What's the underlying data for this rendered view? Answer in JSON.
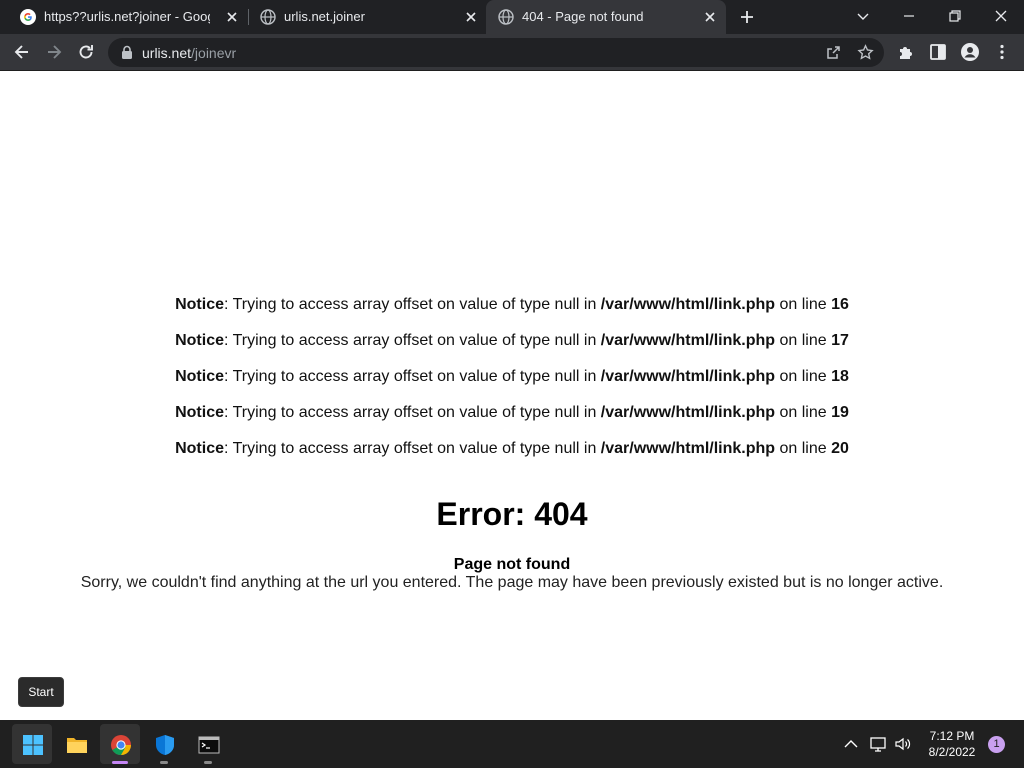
{
  "browser": {
    "tabs": [
      {
        "title": "https??urlis.net?joiner - Google S",
        "favicon": "google-g-icon",
        "active": false
      },
      {
        "title": "urlis.net.joiner",
        "favicon": "globe-icon",
        "active": false
      },
      {
        "title": "404 - Page not found",
        "favicon": "globe-icon",
        "active": true
      }
    ],
    "address": {
      "host": "urlis.net",
      "path": "/joinevr"
    }
  },
  "page": {
    "notices": [
      {
        "label": "Notice",
        "text": ": Trying to access array offset on value of type null in ",
        "file": "/var/www/html/link.php",
        "mid": " on line ",
        "line": "16"
      },
      {
        "label": "Notice",
        "text": ": Trying to access array offset on value of type null in ",
        "file": "/var/www/html/link.php",
        "mid": " on line ",
        "line": "17"
      },
      {
        "label": "Notice",
        "text": ": Trying to access array offset on value of type null in ",
        "file": "/var/www/html/link.php",
        "mid": " on line ",
        "line": "18"
      },
      {
        "label": "Notice",
        "text": ": Trying to access array offset on value of type null in ",
        "file": "/var/www/html/link.php",
        "mid": " on line ",
        "line": "19"
      },
      {
        "label": "Notice",
        "text": ": Trying to access array offset on value of type null in ",
        "file": "/var/www/html/link.php",
        "mid": " on line ",
        "line": "20"
      }
    ],
    "error_title": "Error: 404",
    "error_subtitle": "Page not found",
    "error_message": "Sorry, we couldn't find anything at the url you entered. The page may have been previously existed but is no longer active."
  },
  "tooltip": {
    "text": "Start"
  },
  "taskbar": {
    "apps": [
      "windows-start-icon",
      "file-explorer-icon",
      "chrome-icon",
      "windows-security-icon",
      "terminal-icon"
    ],
    "tray": [
      "chevron-up-icon",
      "network-icon",
      "speaker-icon"
    ],
    "time": "7:12 PM",
    "date": "8/2/2022",
    "notification_count": "1"
  },
  "colors": {
    "tabstrip": "#202124",
    "toolbar": "#35363a",
    "taskbar": "#202020",
    "accent": "#c586f5"
  }
}
